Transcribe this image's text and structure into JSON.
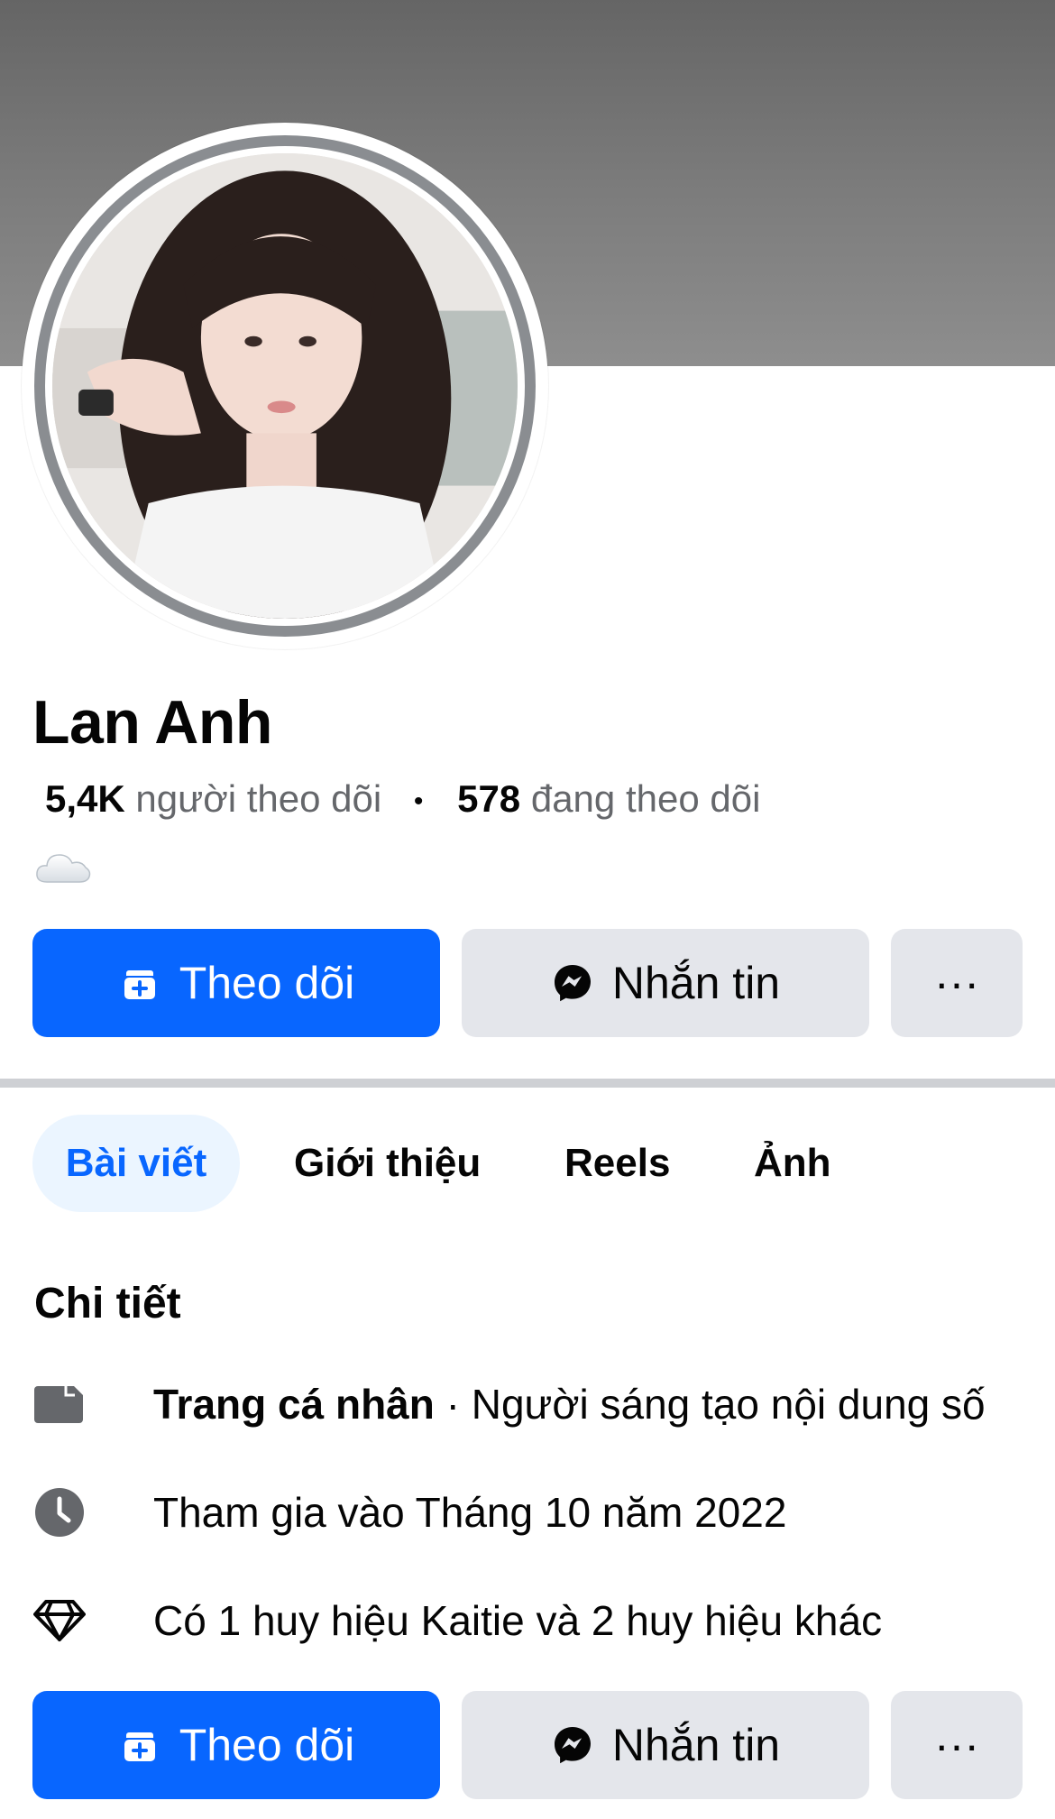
{
  "profile": {
    "name": "Lan Anh",
    "followers_count": "5,4K",
    "followers_label": "người theo dõi",
    "separator": "•",
    "following_count": "578",
    "following_label": "đang theo dõi",
    "bio_icon": "cloud-emoji"
  },
  "actions": {
    "follow_label": "Theo dõi",
    "message_label": "Nhắn tin",
    "more_label": "···"
  },
  "tabs": [
    {
      "label": "Bài viết",
      "active": true
    },
    {
      "label": "Giới thiệu",
      "active": false
    },
    {
      "label": "Reels",
      "active": false
    },
    {
      "label": "Ảnh",
      "active": false
    }
  ],
  "details": {
    "title": "Chi tiết",
    "items": [
      {
        "icon": "page-icon",
        "bold": "Trang cá nhân",
        "text": " · Người sáng tạo nội dung số"
      },
      {
        "icon": "clock-icon",
        "bold": "",
        "text": "Tham gia vào Tháng 10 năm 2022"
      },
      {
        "icon": "diamond-icon",
        "bold": "",
        "text": "Có 1 huy hiệu Kaitie và 2 huy hiệu khác"
      }
    ]
  },
  "colors": {
    "accent": "#0866ff",
    "button_grey": "#e4e6eb",
    "active_tab_bg": "#ebf5ff",
    "secondary_text": "#65676b"
  }
}
